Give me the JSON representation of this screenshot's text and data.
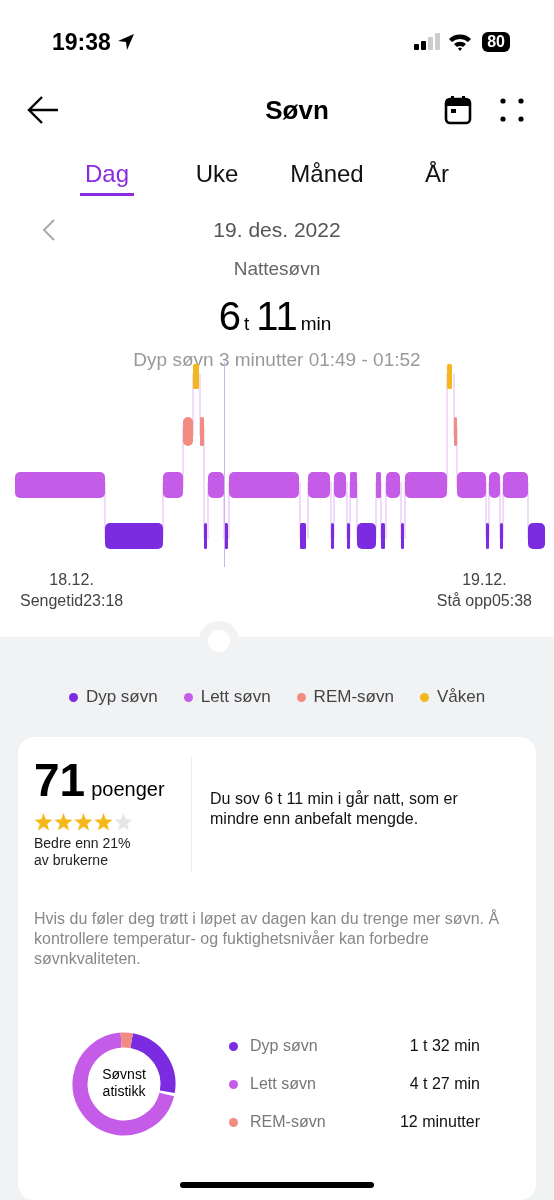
{
  "status_bar": {
    "time": "19:38",
    "battery": "80"
  },
  "header": {
    "title": "Søvn"
  },
  "tabs": [
    {
      "label": "Dag",
      "selected": true
    },
    {
      "label": "Uke",
      "selected": false
    },
    {
      "label": "Måned",
      "selected": false
    },
    {
      "label": "År",
      "selected": false
    }
  ],
  "date": "19. des. 2022",
  "section": "Nattesøvn",
  "duration": {
    "hours": "6",
    "hours_unit": "t",
    "minutes": "11",
    "minutes_unit": "min"
  },
  "hypnogram": {
    "tooltip": "Dyp søvn 3 minutter 01:49 - 01:52",
    "start": {
      "date": "18.12.",
      "label": "Sengetid23:18"
    },
    "end": {
      "date": "19.12.",
      "label": "Stå opp05:38"
    }
  },
  "legend": [
    {
      "label": "Dyp søvn",
      "color": "#7b2be0"
    },
    {
      "label": "Lett søvn",
      "color": "#c55ce8"
    },
    {
      "label": "REM-søvn",
      "color": "#f28b82"
    },
    {
      "label": "Våken",
      "color": "#f4b81e"
    }
  ],
  "score": {
    "value": "71",
    "unit": "poenger",
    "stars": 4,
    "comparison": "Bedre enn 21%\nav brukerne",
    "summary": "Du sov 6 t 11 min i går natt, som er mindre enn anbefalt mengde.",
    "advice": "Hvis du føler deg trøtt i løpet av dagen kan du trenge mer søvn. Å kontrollere temperatur- og fuktighetsnivåer kan forbedre søvnkvaliteten."
  },
  "statistics": {
    "title": "Søvnst\natistikk",
    "rows": [
      {
        "label": "Dyp søvn",
        "value": "1 t 32 min",
        "color": "#7b2be0"
      },
      {
        "label": "Lett søvn",
        "value": "4 t 27 min",
        "color": "#c55ce8"
      },
      {
        "label": "REM-søvn",
        "value": "12 minutter",
        "color": "#f28b82"
      }
    ]
  }
}
